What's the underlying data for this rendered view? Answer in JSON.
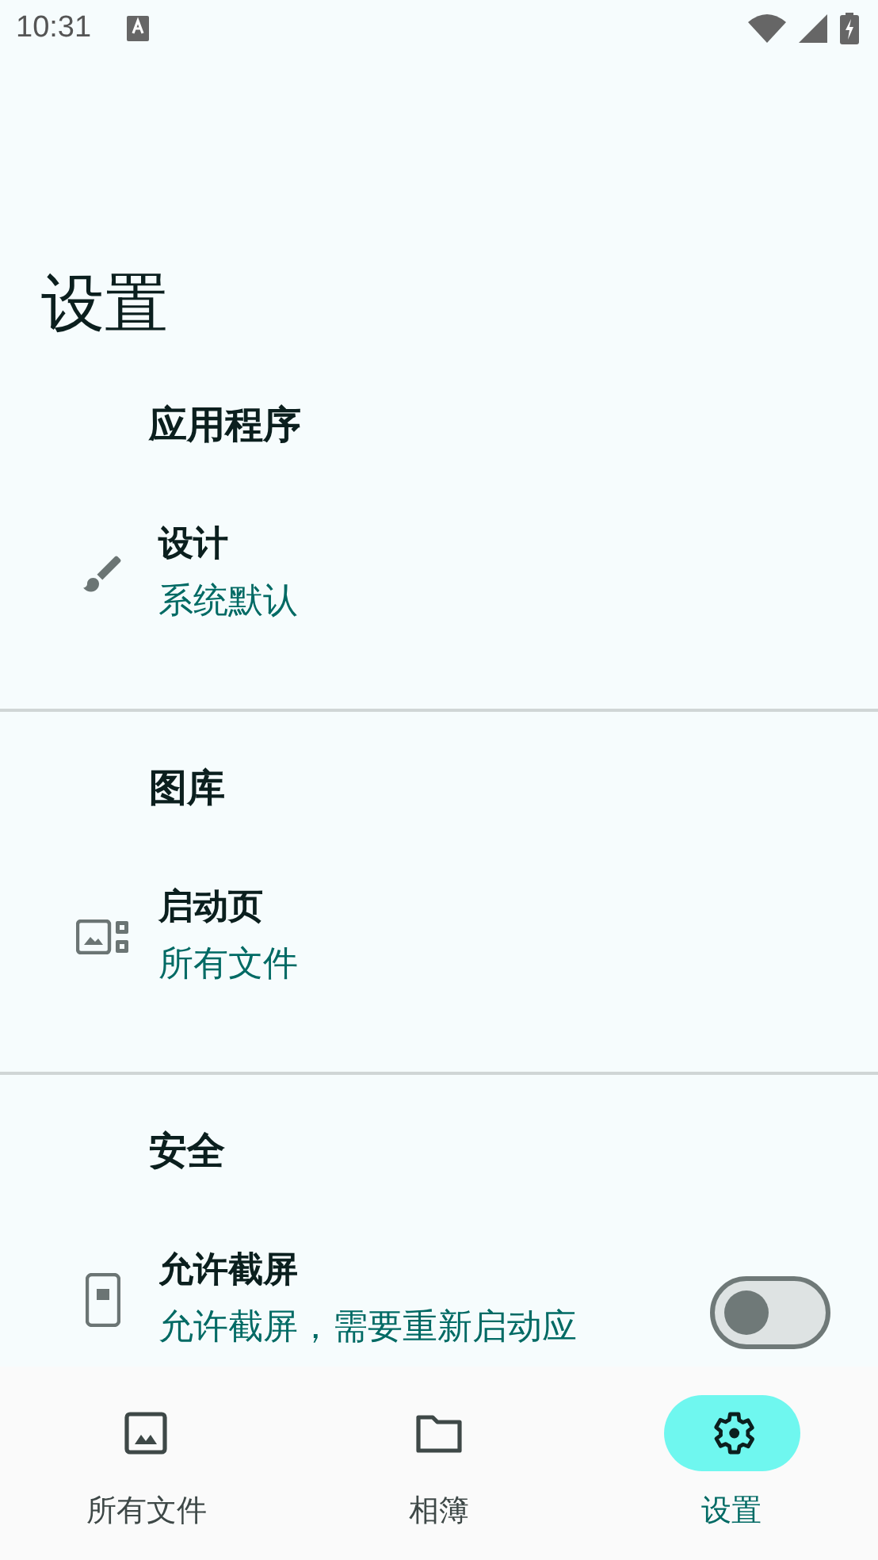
{
  "status_bar": {
    "time": "10:31"
  },
  "title": "设置",
  "sections": [
    {
      "header": "应用程序",
      "items": [
        {
          "kind": "link",
          "title": "设计",
          "subtitle": "系统默认"
        }
      ]
    },
    {
      "header": "图库",
      "items": [
        {
          "kind": "link",
          "title": "启动页",
          "subtitle": "所有文件"
        }
      ]
    },
    {
      "header": "安全",
      "items": [
        {
          "kind": "switch",
          "title": "允许截屏",
          "subtitle": "允许截屏，需要重新启动应",
          "checked": false
        }
      ]
    }
  ],
  "nav": [
    {
      "label": "所有文件",
      "selected": false
    },
    {
      "label": "相簿",
      "selected": false
    },
    {
      "label": "设置",
      "selected": true
    }
  ]
}
